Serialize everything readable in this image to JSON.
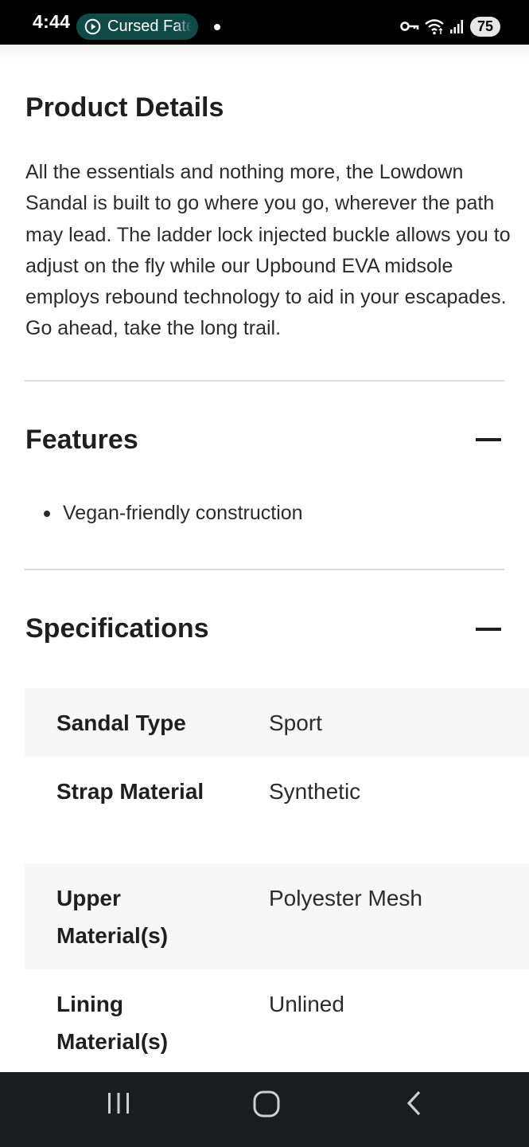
{
  "status_bar": {
    "time": "4:44",
    "media_title": "Cursed Fate",
    "battery_level": "75",
    "icons": [
      "play-circle-icon",
      "notification-dot-icon",
      "vpn-key-icon",
      "wifi-icon",
      "cellular-signal-icon",
      "battery-icon"
    ]
  },
  "product_details": {
    "title": "Product Details",
    "description": "All the essentials and nothing more, the Lowdown Sandal is built to go where you go, wherever the path may lead. The ladder lock injected buckle allows you to adjust on the fly while our Upbound EVA midsole employs rebound technology to aid in your escapades. Go ahead, take the long trail."
  },
  "features": {
    "title": "Features",
    "toggle_icon": "minus-icon",
    "items": [
      "Vegan-friendly construction"
    ]
  },
  "specifications": {
    "title": "Specifications",
    "toggle_icon": "minus-icon",
    "rows": [
      {
        "label": "Sandal Type",
        "value": "Sport"
      },
      {
        "label": "Strap Material",
        "value": "Synthetic"
      },
      {
        "label": "Upper Material(s)",
        "value": "Polyester Mesh"
      },
      {
        "label": "Lining Material(s)",
        "value": "Unlined"
      }
    ]
  },
  "nav_bar": {
    "icons": [
      "recent-apps-icon",
      "home-icon",
      "back-icon"
    ]
  },
  "colors": {
    "status_bar_bg": "#000000",
    "media_pill_bg": "#0f4a47",
    "nav_bar_bg": "#1b1c20",
    "shaded_row_bg": "#f7f7f7",
    "divider": "#dcdcdc",
    "text": "#1f1f1f"
  }
}
